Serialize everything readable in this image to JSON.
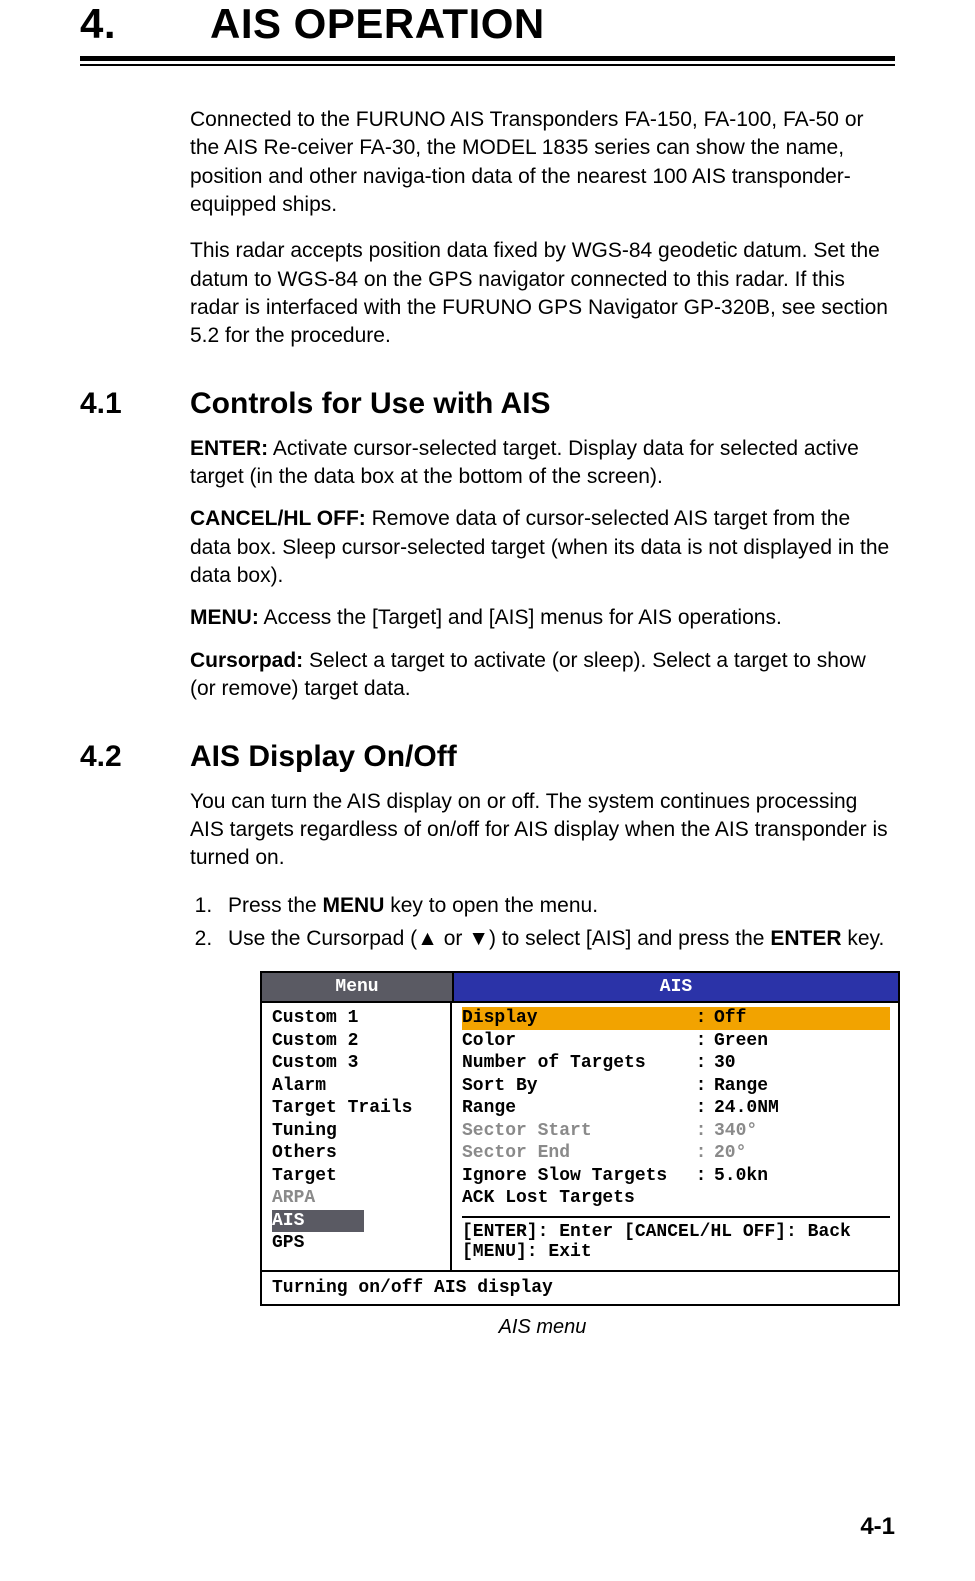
{
  "chapter": {
    "num": "4.",
    "title": "AIS OPERATION"
  },
  "intro": {
    "p1": "Connected to the FURUNO AIS Transponders FA-150, FA-100, FA-50 or the AIS Re-ceiver FA-30, the MODEL 1835 series can show the name, position and other naviga-tion data of the nearest 100 AIS transponder-equipped ships.",
    "p2": "This radar accepts position data fixed by WGS-84 geodetic datum. Set the datum to WGS-84 on the GPS navigator connected to this radar. If this radar is interfaced with the FURUNO GPS Navigator GP-320B, see section 5.2 for the procedure."
  },
  "s41": {
    "num": "4.1",
    "title": "Controls for Use with AIS",
    "enter_l": "ENTER:",
    "enter_t": " Activate cursor-selected target. Display data for selected active target (in the data box at the bottom of the screen).",
    "cancel_l": "CANCEL/HL OFF:",
    "cancel_t": " Remove data of cursor-selected AIS target from the data box. Sleep cursor-selected target (when its data is not displayed in the data box).",
    "menu_l": "MENU:",
    "menu_t": " Access the [Target] and [AIS] menus for AIS operations.",
    "cursor_l": "Cursorpad:",
    "cursor_t": " Select a target to activate (or sleep). Select a target to show (or remove) target data."
  },
  "s42": {
    "num": "4.2",
    "title": "AIS Display On/Off",
    "p": "You can turn the AIS display on or off. The system continues processing AIS targets regardless of on/off for AIS display when the AIS transponder is turned on.",
    "step1a": "Press the ",
    "step1b": "MENU",
    "step1c": " key to open the menu.",
    "step2a": "Use the Cursorpad (▲ or ▼) to select [AIS] and press the ",
    "step2b": "ENTER",
    "step2c": " key."
  },
  "menu": {
    "left_title": "Menu",
    "right_title": "AIS",
    "left": {
      "i0": "Custom 1",
      "i1": "Custom 2",
      "i2": "Custom 3",
      "i3": "Alarm",
      "i4": "Target Trails",
      "i5": "Tuning",
      "i6": "Others",
      "i7": "Target",
      "i8": "ARPA",
      "i9": "AIS",
      "i10": "GPS"
    },
    "rows": {
      "r0k": "Display",
      "r0v": "Off",
      "r1k": "Color",
      "r1v": "Green",
      "r2k": "Number of Targets",
      "r2v": " 30",
      "r3k": "Sort By",
      "r3v": "Range",
      "r4k": "Range",
      "r4v": "24.0NM",
      "r5k": "Sector Start",
      "r5v": "340°",
      "r6k": "Sector End",
      "r6v": " 20°",
      "r7k": "Ignore Slow Targets",
      "r7v": "5.0kn",
      "r8k": "ACK Lost Targets",
      "r8v": ""
    },
    "hint1": "[ENTER]: Enter [CANCEL/HL OFF]: Back",
    "hint2": "[MENU]: Exit",
    "status": "Turning on/off AIS display"
  },
  "caption": "AIS menu",
  "page": "4-1"
}
